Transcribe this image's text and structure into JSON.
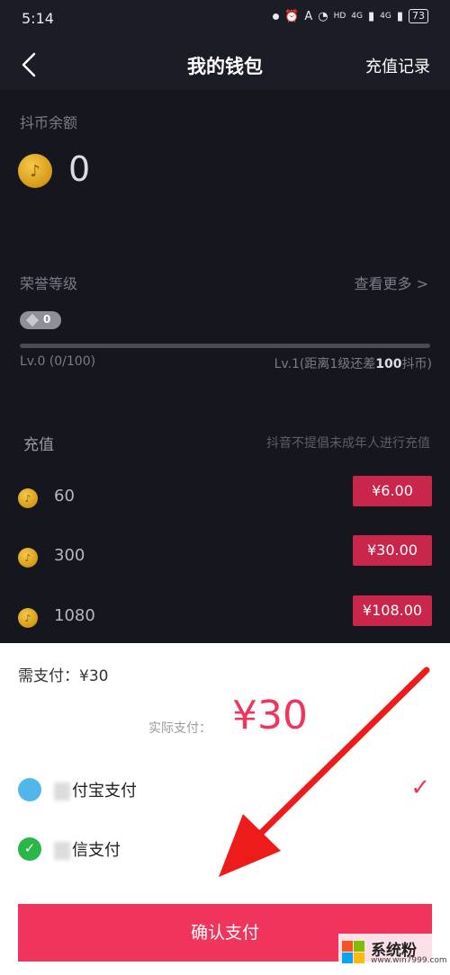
{
  "status": {
    "time": "5:14",
    "signal1": "HD",
    "net1": "4G",
    "net2": "4G",
    "battery": "73"
  },
  "nav": {
    "title": "我的钱包",
    "right": "充值记录"
  },
  "balance": {
    "label": "抖币余额",
    "value": "0"
  },
  "honor": {
    "label": "荣誉等级",
    "more": "查看更多 >",
    "level_badge": "0",
    "progress_fraction": 0,
    "left_text": "Lv.0 (0/100)",
    "right_prefix": "Lv.1(距离1级还差",
    "right_value": "100",
    "right_suffix": "抖币)"
  },
  "recharge": {
    "title": "充值",
    "notice": "抖音不提倡未成年人进行充值",
    "options": [
      {
        "amount": "60",
        "price": "¥6.00"
      },
      {
        "amount": "300",
        "price": "¥30.00"
      },
      {
        "amount": "1080",
        "price": "¥108.00"
      }
    ]
  },
  "sheet": {
    "need_pay": "需支付：¥30",
    "actual_label": "实际支付：",
    "actual_amount": "¥30",
    "alipay_label": "付宝支付",
    "wechat_label": "信支付",
    "confirm": "确认支付"
  },
  "watermark": {
    "name": "系统粉",
    "url": "www.win7999.com"
  },
  "colors": {
    "accent": "#f0345c",
    "price_button": "#c8264a",
    "background": "#16161f"
  }
}
